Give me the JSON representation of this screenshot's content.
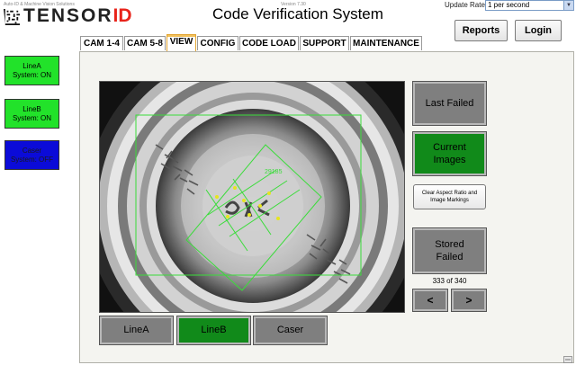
{
  "header": {
    "brand_tagline": "Auto-ID & Machine Vision Solutions",
    "brand_name": "TENSOR",
    "brand_suffix": "ID",
    "version": "Version 7.30",
    "title": "Code Verification System",
    "update_rate_label": "Update Rate:",
    "update_rate_value": "1 per second",
    "reports_label": "Reports",
    "login_label": "Login"
  },
  "tabs": [
    {
      "label": "CAM 1-4",
      "active": false
    },
    {
      "label": "CAM 5-8",
      "active": false
    },
    {
      "label": "VIEW",
      "active": true
    },
    {
      "label": "CONFIG",
      "active": false
    },
    {
      "label": "CODE LOAD",
      "active": false
    },
    {
      "label": "SUPPORT",
      "active": false
    },
    {
      "label": "MAINTENANCE",
      "active": false
    }
  ],
  "lines": [
    {
      "name": "LineA",
      "status": "System: ON",
      "state": "on"
    },
    {
      "name": "LineB",
      "status": "System: ON",
      "state": "on"
    },
    {
      "name": "Caser",
      "status": "System: OFF",
      "state": "off"
    }
  ],
  "viewer": {
    "overlay_code": "29185"
  },
  "actions": {
    "last_failed": [
      "Last Failed"
    ],
    "current_images": [
      "Current",
      "Images"
    ],
    "clear_markings": "Clear Aspect Ratio and Image Markings",
    "stored_failed": [
      "Stored",
      "Failed"
    ],
    "counter": "333 of 340",
    "prev": "<",
    "next": ">"
  },
  "line_selector": [
    {
      "label": "LineA",
      "selected": false
    },
    {
      "label": "LineB",
      "selected": true
    },
    {
      "label": "Caser",
      "selected": false
    }
  ],
  "colors": {
    "status_on": "#22e22a",
    "status_off": "#0b0bd8",
    "selected_green": "#118a1a",
    "button_gray": "#7f7f7f",
    "overlay_green": "#3bdc3b",
    "overlay_yellow": "#e6e61e",
    "active_tab": "#e2a431",
    "brand_red": "#e8231a"
  }
}
